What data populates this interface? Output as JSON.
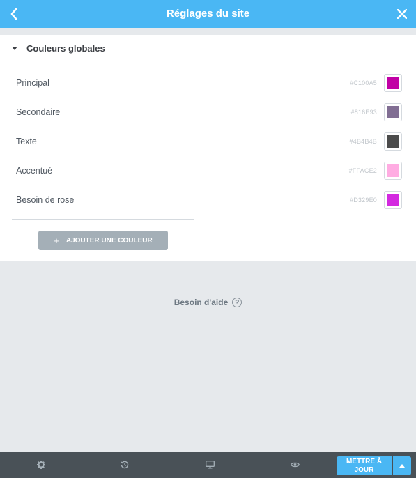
{
  "header": {
    "title": "Réglages du site",
    "back_icon": "chevron-left-icon",
    "close_icon": "close-icon",
    "background": "#4ab7f4"
  },
  "section": {
    "title": "Couleurs globales",
    "caret_icon": "caret-down-icon"
  },
  "colors": [
    {
      "name": "Principal",
      "hex": "#C100A5",
      "swatch": "#C100A5"
    },
    {
      "name": "Secondaire",
      "hex": "#816E93",
      "swatch": "#816E93"
    },
    {
      "name": "Texte",
      "hex": "#4B4B4B",
      "swatch": "#4B4B4B"
    },
    {
      "name": "Accentué",
      "hex": "#FFACE2",
      "swatch": "#FFACE2"
    },
    {
      "name": "Besoin de rose",
      "hex": "#D329E0",
      "swatch": "#D329E0"
    }
  ],
  "add_button": {
    "plus": "+",
    "label": "AJOUTER UNE COULEUR"
  },
  "help": {
    "label": "Besoin d'aide",
    "icon": "question-icon",
    "icon_glyph": "?"
  },
  "footer": {
    "icons": [
      "settings-icon",
      "history-icon",
      "responsive-icon",
      "preview-icon"
    ],
    "update_label": "METTRE À JOUR",
    "arrow_icon": "caret-up-icon",
    "background": "#495157"
  }
}
